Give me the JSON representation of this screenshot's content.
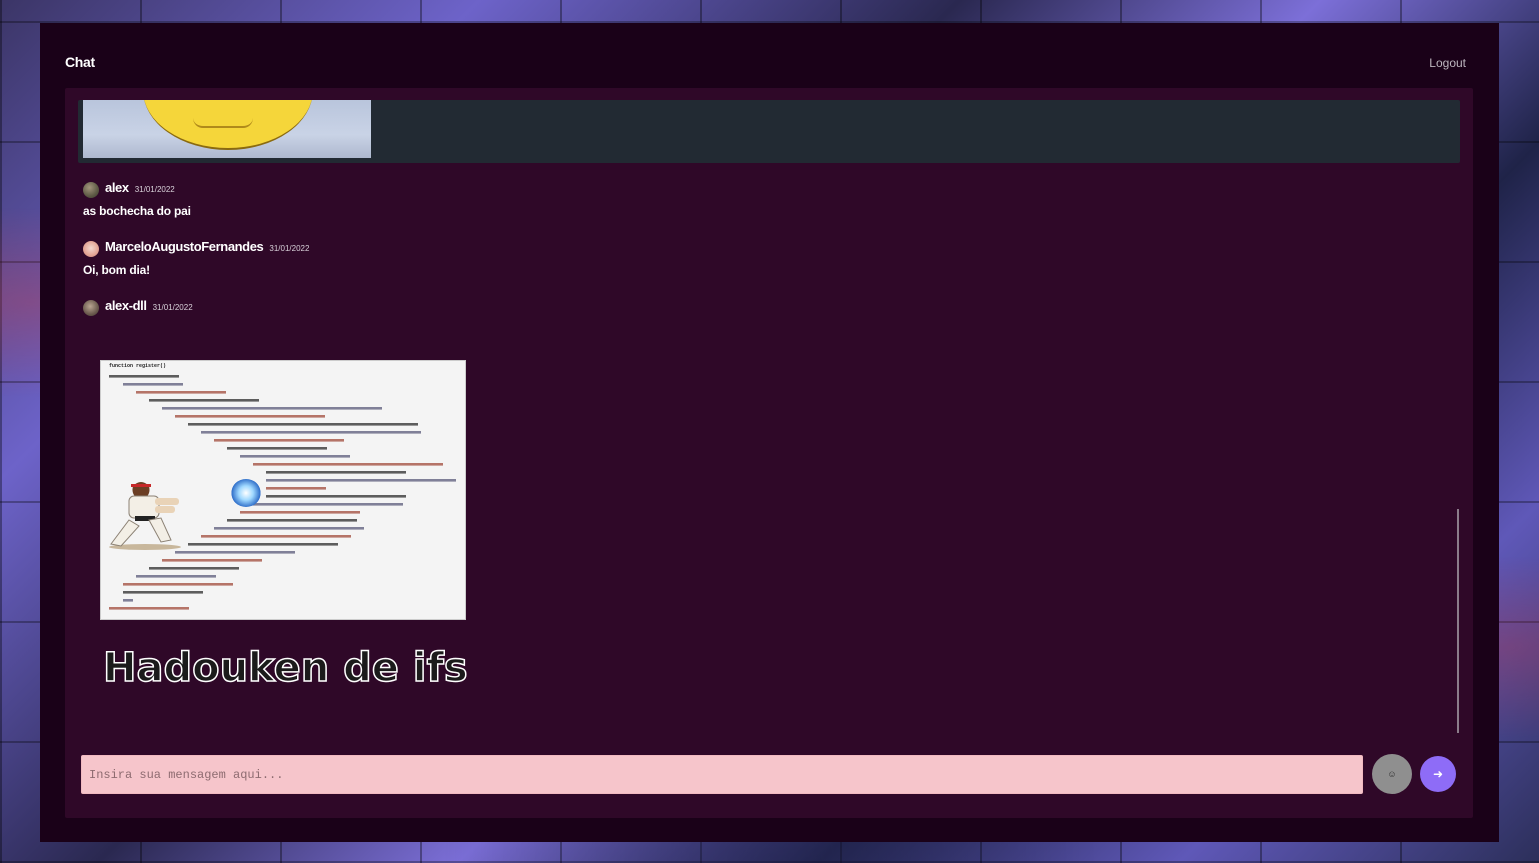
{
  "header": {
    "title": "Chat",
    "logout_label": "Logout"
  },
  "messages": [
    {
      "username": "alex",
      "date": "31/01/2022",
      "text": "as bochecha do pai"
    },
    {
      "username": "MarceloAugustoFernandes",
      "date": "31/01/2022",
      "text": "Oi, bom dia!"
    },
    {
      "username": "alex-dll",
      "date": "31/01/2022",
      "text": ""
    }
  ],
  "meme": {
    "caption": "Hadouken de ifs",
    "code_header": "function register()"
  },
  "composer": {
    "placeholder": "Insira sua mensagem aqui...",
    "value": ""
  },
  "icons": {
    "emoji_button": "emoji-icon",
    "send_button": "arrow-right-icon"
  },
  "colors": {
    "app_background": "#1a0118",
    "chat_panel": "#2f0828",
    "input_background": "#f6c5cb",
    "send_button": "#8e6cf7",
    "emoji_button": "#8f8f8f"
  }
}
